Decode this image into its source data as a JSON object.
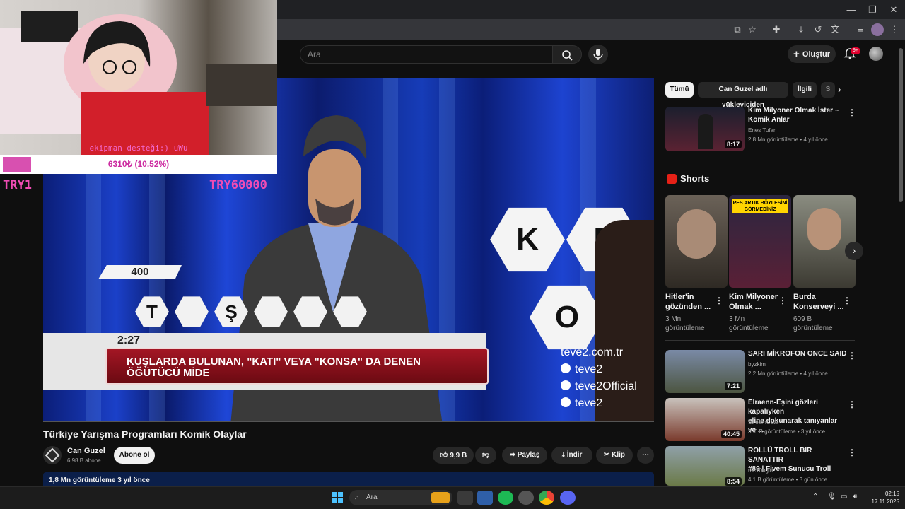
{
  "overlay": {
    "webcam_caption": "ekipman desteği:) uWu",
    "donation_text": "6310₺ (10.52%)",
    "donation_progress": 0.1052,
    "goal_min": "TRY1",
    "goal_max": "TRY60000"
  },
  "header": {
    "search_placeholder": "Ara",
    "create_label": "Oluştur",
    "notification_count": "9+"
  },
  "player": {
    "score": "400",
    "timer": "2:27",
    "question_line1": "KUŞLARDA BULUNAN, \"KATI\" VEYA \"KONSA\" DA DENEN",
    "question_line2": "ÖĞÜTÜCÜ MİDE",
    "letters": [
      "T",
      "",
      "Ş",
      "",
      "",
      ""
    ],
    "big_letters": [
      "K",
      "E",
      "O"
    ],
    "social": [
      "teve2.com.tr",
      "teve2",
      "teve2Official",
      "teve2"
    ]
  },
  "video": {
    "title": "Türkiye Yarışma Programları Komik Olaylar",
    "channel": "Can Guzel",
    "subscribers": "6,98 B abone",
    "subscribe_label": "Abone ol",
    "likes": "9,9 B",
    "share_label": "Paylaş",
    "download_label": "İndir",
    "clip_label": "Klip",
    "description_meta": "1,8 Mn görüntüleme  3 yıl önce"
  },
  "sidebar": {
    "chips": [
      "Tümü",
      "Can Guzel adlı yükleyiciden",
      "İlgili",
      "S"
    ],
    "top_video": {
      "title_l1": "Kim Milyoner Olmak İster ~",
      "title_l2": "Komik Anlar",
      "channel": "Enes Tufan",
      "meta": "2,8 Mn görüntüleme • 4 yıl önce",
      "duration": "8:17"
    },
    "shorts_heading": "Shorts",
    "shorts": [
      {
        "title_l1": "Hitler'in",
        "title_l2": "gözünden ...",
        "views_l1": "3 Mn",
        "views_l2": "görüntüleme",
        "thumb_text": ""
      },
      {
        "title_l1": "Kim Milyoner",
        "title_l2": "Olmak ...",
        "views_l1": "3 Mn",
        "views_l2": "görüntüleme",
        "thumb_text": "PES ARTIK BÖYLESİNİ GÖRMEDİNİZ"
      },
      {
        "title_l1": "Burda",
        "title_l2": "Konserveyi ...",
        "views_l1": "609 B",
        "views_l2": "görüntüleme",
        "thumb_text": ""
      }
    ],
    "videos": [
      {
        "title_l1": "SARI MİKROFON ONCE SAID",
        "title_l2": "",
        "channel": "byzkim",
        "meta": "2,2 Mn görüntüleme • 4 yıl önce",
        "duration": "7:21"
      },
      {
        "title_l1": "Elraenn-Eşini gözleri kapalıyken",
        "title_l2": "eline dokunarak tanıyanlar ve ...",
        "channel": "StreamCuts",
        "meta": "306 B görüntüleme • 3 yıl önce",
        "duration": "40:45"
      },
      {
        "title_l1": "ROLLÜ TROLL BIR SANATTIR",
        "title_l2": "#89 | Fivem Sunucu Troll",
        "channel": "rac10oglu",
        "meta": "4,1 B görüntüleme • 3 gün önce",
        "duration": "8:54"
      }
    ]
  },
  "taskbar": {
    "search_placeholder": "Ara",
    "time": "02:15",
    "date": "17.11.2025"
  }
}
